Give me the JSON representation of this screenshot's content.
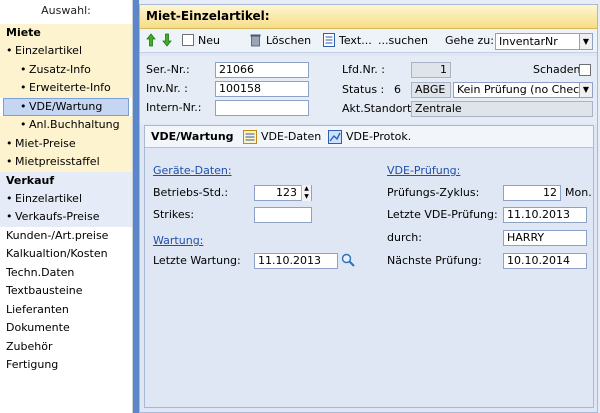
{
  "sidebar": {
    "header": "Auswahl:",
    "miete": {
      "title": "Miete",
      "items": [
        "Einzelartikel",
        "Zusatz-Info",
        "Erweiterte-Info",
        "VDE/Wartung",
        "Anl.Buchhaltung",
        "Miet-Preise",
        "Mietpreisstaffel"
      ]
    },
    "verkauf": {
      "title": "Verkauf",
      "items": [
        "Einzelartikel",
        "Verkaufs-Preise"
      ]
    },
    "other": [
      "Kunden-/Art.preise",
      "Kalkualtion/Kosten",
      "Techn.Daten",
      "Textbausteine",
      "Lieferanten",
      "Dokumente",
      "Zubehör",
      "Fertigung"
    ],
    "bullet": "•"
  },
  "window": {
    "title": "Miet-Einzelartikel:"
  },
  "toolbar": {
    "neu": "Neu",
    "loeschen": "Löschen",
    "text": "Text...",
    "suchen": "...suchen",
    "gehe_zu": "Gehe zu:",
    "gehe_zu_value": "InventarNr"
  },
  "form": {
    "ser_nr_label": "Ser.-Nr.:",
    "ser_nr": "21066",
    "inv_nr_label": "Inv.Nr. :",
    "inv_nr": "100158",
    "intern_nr_label": "Intern-Nr.:",
    "intern_nr": "",
    "lfd_nr_label": "Lfd.Nr. :",
    "lfd_nr": "1",
    "status_label": "Status :",
    "status_num": "6",
    "status_code": "ABGE",
    "status_text": "Kein Prüfung (no Check)",
    "standort_label": "Akt.Standort :",
    "standort": "Zentrale",
    "schaden_label": "Schaden"
  },
  "tabs": {
    "title": "VDE/Wartung",
    "vde_daten": "VDE-Daten",
    "vde_protok": "VDE-Protok."
  },
  "geraete": {
    "section": "Geräte-Daten:",
    "betriebs_label": "Betriebs-Std.:",
    "betriebs": "123",
    "strikes_label": "Strikes:",
    "strikes": ""
  },
  "wartung": {
    "section": "Wartung:",
    "letzte_label": "Letzte Wartung:",
    "letzte": "11.10.2013"
  },
  "pruefung": {
    "section": "VDE-Prüfung:",
    "zyklus_label": "Prüfungs-Zyklus:",
    "zyklus": "12",
    "zyklus_unit": "Mon.",
    "letzte_label": "Letzte VDE-Prüfung:",
    "letzte": "11.10.2013",
    "durch_label": "durch:",
    "durch": "HARRY",
    "naechste_label": "Nächste Prüfung:",
    "naechste": "10.10.2014"
  },
  "colors": {
    "accent": "#5b87c9",
    "miete_bg": "#fdf3cf",
    "verkauf_bg": "#e6ecf7",
    "link": "#1f4fa8"
  }
}
